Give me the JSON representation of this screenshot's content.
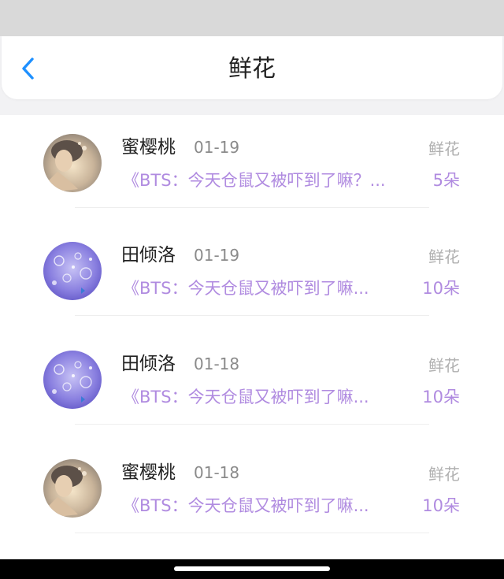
{
  "nav": {
    "title": "鲜花"
  },
  "items": [
    {
      "user": "蜜樱桃",
      "date": "01-19",
      "type": "鲜花",
      "description": "《BTS：今天仓鼠又被吓到了嘛？...",
      "count": "5朵",
      "avatar": "portrait-avatar"
    },
    {
      "user": "田倾洛",
      "date": "01-19",
      "type": "鲜花",
      "description": "《BTS：今天仓鼠又被吓到了嘛...",
      "count": "10朵",
      "avatar": "bubbles-avatar"
    },
    {
      "user": "田倾洛",
      "date": "01-18",
      "type": "鲜花",
      "description": "《BTS：今天仓鼠又被吓到了嘛...",
      "count": "10朵",
      "avatar": "bubbles-avatar"
    },
    {
      "user": "蜜樱桃",
      "date": "01-18",
      "type": "鲜花",
      "description": "《BTS：今天仓鼠又被吓到了嘛...",
      "count": "10朵",
      "avatar": "portrait-avatar"
    }
  ],
  "colors": {
    "accent_blue": "#1e90ff",
    "accent_purple": "#b08be0",
    "status_bar": "#d9d9d9"
  }
}
